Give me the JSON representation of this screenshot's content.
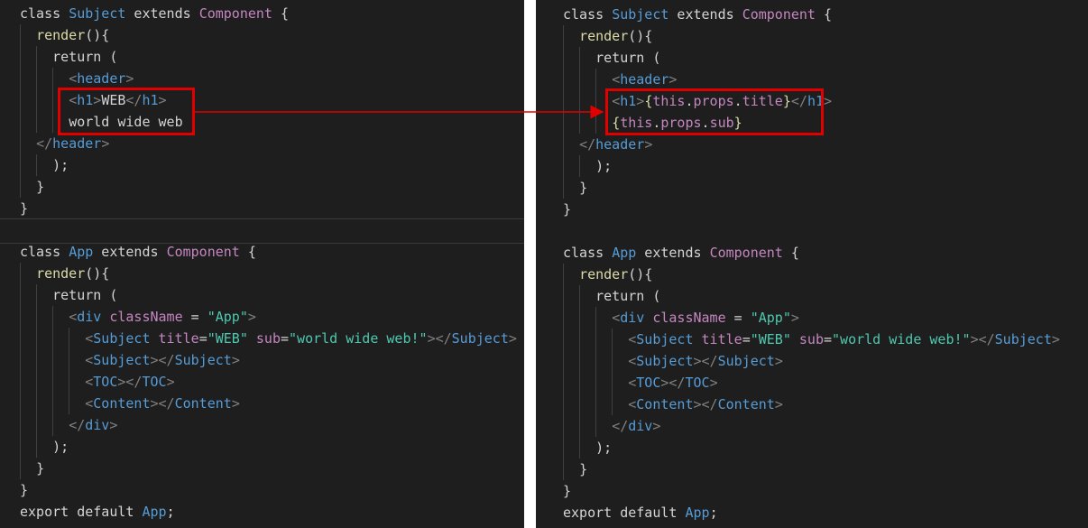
{
  "left": {
    "lines": [
      [
        {
          "t": "class ",
          "c": "txt"
        },
        {
          "t": "Subject",
          "c": "name-blue"
        },
        {
          "t": " extends ",
          "c": "txt"
        },
        {
          "t": "Component",
          "c": "comp"
        },
        {
          "t": " {",
          "c": "txt"
        }
      ],
      [
        {
          "t": "  ",
          "c": "txt"
        },
        {
          "t": "render",
          "c": "fn"
        },
        {
          "t": "(){",
          "c": "txt"
        }
      ],
      [
        {
          "t": "    ",
          "c": "txt"
        },
        {
          "t": "return",
          "c": "txt"
        },
        {
          "t": " (",
          "c": "txt"
        }
      ],
      [
        {
          "t": "      ",
          "c": "txt"
        },
        {
          "t": "<",
          "c": "brk"
        },
        {
          "t": "header",
          "c": "tag"
        },
        {
          "t": ">",
          "c": "brk"
        }
      ],
      [
        {
          "t": "      ",
          "c": "txt"
        },
        {
          "t": "<",
          "c": "brk"
        },
        {
          "t": "h1",
          "c": "tag"
        },
        {
          "t": ">",
          "c": "brk"
        },
        {
          "t": "WEB",
          "c": "txt"
        },
        {
          "t": "</",
          "c": "brk"
        },
        {
          "t": "h1",
          "c": "tag"
        },
        {
          "t": ">",
          "c": "brk"
        }
      ],
      [
        {
          "t": "      ",
          "c": "txt"
        },
        {
          "t": "world wide web",
          "c": "txt"
        }
      ],
      [
        {
          "t": "  ",
          "c": "txt"
        },
        {
          "t": "</",
          "c": "brk"
        },
        {
          "t": "header",
          "c": "tag"
        },
        {
          "t": ">",
          "c": "brk"
        }
      ],
      [
        {
          "t": "    ",
          "c": "txt"
        },
        {
          "t": ");",
          "c": "txt"
        }
      ],
      [
        {
          "t": "  ",
          "c": "txt"
        },
        {
          "t": "}",
          "c": "txt"
        }
      ],
      [
        {
          "t": "}",
          "c": "txt"
        }
      ],
      [
        {
          "t": "",
          "c": "txt"
        }
      ],
      [
        {
          "t": "class ",
          "c": "txt"
        },
        {
          "t": "App",
          "c": "name-blue"
        },
        {
          "t": " extends ",
          "c": "txt"
        },
        {
          "t": "Component",
          "c": "comp"
        },
        {
          "t": " {",
          "c": "txt"
        }
      ],
      [
        {
          "t": "  ",
          "c": "txt"
        },
        {
          "t": "render",
          "c": "fn"
        },
        {
          "t": "(){",
          "c": "txt"
        }
      ],
      [
        {
          "t": "    ",
          "c": "txt"
        },
        {
          "t": "return",
          "c": "txt"
        },
        {
          "t": " (",
          "c": "txt"
        }
      ],
      [
        {
          "t": "      ",
          "c": "txt"
        },
        {
          "t": "<",
          "c": "brk"
        },
        {
          "t": "div",
          "c": "tag"
        },
        {
          "t": " ",
          "c": "txt"
        },
        {
          "t": "className",
          "c": "attr"
        },
        {
          "t": " = ",
          "c": "txt"
        },
        {
          "t": "\"App\"",
          "c": "str"
        },
        {
          "t": ">",
          "c": "brk"
        }
      ],
      [
        {
          "t": "        ",
          "c": "txt"
        },
        {
          "t": "<",
          "c": "brk"
        },
        {
          "t": "Subject",
          "c": "tag"
        },
        {
          "t": " ",
          "c": "txt"
        },
        {
          "t": "title",
          "c": "attr"
        },
        {
          "t": "=",
          "c": "txt"
        },
        {
          "t": "\"WEB\"",
          "c": "str"
        },
        {
          "t": " ",
          "c": "txt"
        },
        {
          "t": "sub",
          "c": "attr"
        },
        {
          "t": "=",
          "c": "txt"
        },
        {
          "t": "\"world wide web!\"",
          "c": "str"
        },
        {
          "t": "></",
          "c": "brk"
        },
        {
          "t": "Subject",
          "c": "tag"
        },
        {
          "t": ">",
          "c": "brk"
        }
      ],
      [
        {
          "t": "        ",
          "c": "txt"
        },
        {
          "t": "<",
          "c": "brk"
        },
        {
          "t": "Subject",
          "c": "tag"
        },
        {
          "t": "></",
          "c": "brk"
        },
        {
          "t": "Subject",
          "c": "tag"
        },
        {
          "t": ">",
          "c": "brk"
        }
      ],
      [
        {
          "t": "        ",
          "c": "txt"
        },
        {
          "t": "<",
          "c": "brk"
        },
        {
          "t": "TOC",
          "c": "tag"
        },
        {
          "t": "></",
          "c": "brk"
        },
        {
          "t": "TOC",
          "c": "tag"
        },
        {
          "t": ">",
          "c": "brk"
        }
      ],
      [
        {
          "t": "        ",
          "c": "txt"
        },
        {
          "t": "<",
          "c": "brk"
        },
        {
          "t": "Content",
          "c": "tag"
        },
        {
          "t": "></",
          "c": "brk"
        },
        {
          "t": "Content",
          "c": "tag"
        },
        {
          "t": ">",
          "c": "brk"
        }
      ],
      [
        {
          "t": "      ",
          "c": "txt"
        },
        {
          "t": "</",
          "c": "brk"
        },
        {
          "t": "div",
          "c": "tag"
        },
        {
          "t": ">",
          "c": "brk"
        }
      ],
      [
        {
          "t": "    ",
          "c": "txt"
        },
        {
          "t": ");",
          "c": "txt"
        }
      ],
      [
        {
          "t": "  ",
          "c": "txt"
        },
        {
          "t": "}",
          "c": "txt"
        }
      ],
      [
        {
          "t": "}",
          "c": "txt"
        }
      ],
      [
        {
          "t": "export default ",
          "c": "txt"
        },
        {
          "t": "App",
          "c": "name-blue"
        },
        {
          "t": ";",
          "c": "txt"
        }
      ]
    ]
  },
  "right": {
    "lines": [
      [
        {
          "t": "class ",
          "c": "txt"
        },
        {
          "t": "Subject",
          "c": "name-blue"
        },
        {
          "t": " extends ",
          "c": "txt"
        },
        {
          "t": "Component",
          "c": "comp"
        },
        {
          "t": " {",
          "c": "txt"
        }
      ],
      [
        {
          "t": "  ",
          "c": "txt"
        },
        {
          "t": "render",
          "c": "fn"
        },
        {
          "t": "(){",
          "c": "txt"
        }
      ],
      [
        {
          "t": "    ",
          "c": "txt"
        },
        {
          "t": "return",
          "c": "txt"
        },
        {
          "t": " (",
          "c": "txt"
        }
      ],
      [
        {
          "t": "      ",
          "c": "txt"
        },
        {
          "t": "<",
          "c": "brk"
        },
        {
          "t": "header",
          "c": "tag"
        },
        {
          "t": ">",
          "c": "brk"
        }
      ],
      [
        {
          "t": "      ",
          "c": "txt"
        },
        {
          "t": "<",
          "c": "brk"
        },
        {
          "t": "h1",
          "c": "tag"
        },
        {
          "t": ">",
          "c": "brk"
        },
        {
          "t": "{",
          "c": "expr"
        },
        {
          "t": "this",
          "c": "this"
        },
        {
          "t": ".",
          "c": "txt"
        },
        {
          "t": "props",
          "c": "this"
        },
        {
          "t": ".",
          "c": "txt"
        },
        {
          "t": "title",
          "c": "this"
        },
        {
          "t": "}",
          "c": "expr"
        },
        {
          "t": "</",
          "c": "brk"
        },
        {
          "t": "h1",
          "c": "tag"
        },
        {
          "t": ">",
          "c": "brk"
        }
      ],
      [
        {
          "t": "      ",
          "c": "txt"
        },
        {
          "t": "{",
          "c": "expr"
        },
        {
          "t": "this",
          "c": "this"
        },
        {
          "t": ".",
          "c": "txt"
        },
        {
          "t": "props",
          "c": "this"
        },
        {
          "t": ".",
          "c": "txt"
        },
        {
          "t": "sub",
          "c": "this"
        },
        {
          "t": "}",
          "c": "expr"
        }
      ],
      [
        {
          "t": "  ",
          "c": "txt"
        },
        {
          "t": "</",
          "c": "brk"
        },
        {
          "t": "header",
          "c": "tag"
        },
        {
          "t": ">",
          "c": "brk"
        }
      ],
      [
        {
          "t": "    ",
          "c": "txt"
        },
        {
          "t": ");",
          "c": "txt"
        }
      ],
      [
        {
          "t": "  ",
          "c": "txt"
        },
        {
          "t": "}",
          "c": "txt"
        }
      ],
      [
        {
          "t": "}",
          "c": "txt"
        }
      ],
      [
        {
          "t": "",
          "c": "txt"
        }
      ],
      [
        {
          "t": "class ",
          "c": "txt"
        },
        {
          "t": "App",
          "c": "name-blue"
        },
        {
          "t": " extends ",
          "c": "txt"
        },
        {
          "t": "Component",
          "c": "comp"
        },
        {
          "t": " {",
          "c": "txt"
        }
      ],
      [
        {
          "t": "  ",
          "c": "txt"
        },
        {
          "t": "render",
          "c": "fn"
        },
        {
          "t": "(){",
          "c": "txt"
        }
      ],
      [
        {
          "t": "    ",
          "c": "txt"
        },
        {
          "t": "return",
          "c": "txt"
        },
        {
          "t": " (",
          "c": "txt"
        }
      ],
      [
        {
          "t": "      ",
          "c": "txt"
        },
        {
          "t": "<",
          "c": "brk"
        },
        {
          "t": "div",
          "c": "tag"
        },
        {
          "t": " ",
          "c": "txt"
        },
        {
          "t": "className",
          "c": "attr"
        },
        {
          "t": " = ",
          "c": "txt"
        },
        {
          "t": "\"App\"",
          "c": "str"
        },
        {
          "t": ">",
          "c": "brk"
        }
      ],
      [
        {
          "t": "        ",
          "c": "txt"
        },
        {
          "t": "<",
          "c": "brk"
        },
        {
          "t": "Subject",
          "c": "tag"
        },
        {
          "t": " ",
          "c": "txt"
        },
        {
          "t": "title",
          "c": "attr"
        },
        {
          "t": "=",
          "c": "txt"
        },
        {
          "t": "\"WEB\"",
          "c": "str"
        },
        {
          "t": " ",
          "c": "txt"
        },
        {
          "t": "sub",
          "c": "attr"
        },
        {
          "t": "=",
          "c": "txt"
        },
        {
          "t": "\"world wide web!\"",
          "c": "str"
        },
        {
          "t": "></",
          "c": "brk"
        },
        {
          "t": "Subject",
          "c": "tag"
        },
        {
          "t": ">",
          "c": "brk"
        }
      ],
      [
        {
          "t": "        ",
          "c": "txt"
        },
        {
          "t": "<",
          "c": "brk"
        },
        {
          "t": "Subject",
          "c": "tag"
        },
        {
          "t": "></",
          "c": "brk"
        },
        {
          "t": "Subject",
          "c": "tag"
        },
        {
          "t": ">",
          "c": "brk"
        }
      ],
      [
        {
          "t": "        ",
          "c": "txt"
        },
        {
          "t": "<",
          "c": "brk"
        },
        {
          "t": "TOC",
          "c": "tag"
        },
        {
          "t": "></",
          "c": "brk"
        },
        {
          "t": "TOC",
          "c": "tag"
        },
        {
          "t": ">",
          "c": "brk"
        }
      ],
      [
        {
          "t": "        ",
          "c": "txt"
        },
        {
          "t": "<",
          "c": "brk"
        },
        {
          "t": "Content",
          "c": "tag"
        },
        {
          "t": "></",
          "c": "brk"
        },
        {
          "t": "Content",
          "c": "tag"
        },
        {
          "t": ">",
          "c": "brk"
        }
      ],
      [
        {
          "t": "      ",
          "c": "txt"
        },
        {
          "t": "</",
          "c": "brk"
        },
        {
          "t": "div",
          "c": "tag"
        },
        {
          "t": ">",
          "c": "brk"
        }
      ],
      [
        {
          "t": "    ",
          "c": "txt"
        },
        {
          "t": ");",
          "c": "txt"
        }
      ],
      [
        {
          "t": "  ",
          "c": "txt"
        },
        {
          "t": "}",
          "c": "txt"
        }
      ],
      [
        {
          "t": "}",
          "c": "txt"
        }
      ],
      [
        {
          "t": "export default ",
          "c": "txt"
        },
        {
          "t": "App",
          "c": "name-blue"
        },
        {
          "t": ";",
          "c": "txt"
        }
      ]
    ]
  },
  "colors": {
    "editor_bg": "#1e1e1e",
    "highlight_red": "#e00000"
  }
}
